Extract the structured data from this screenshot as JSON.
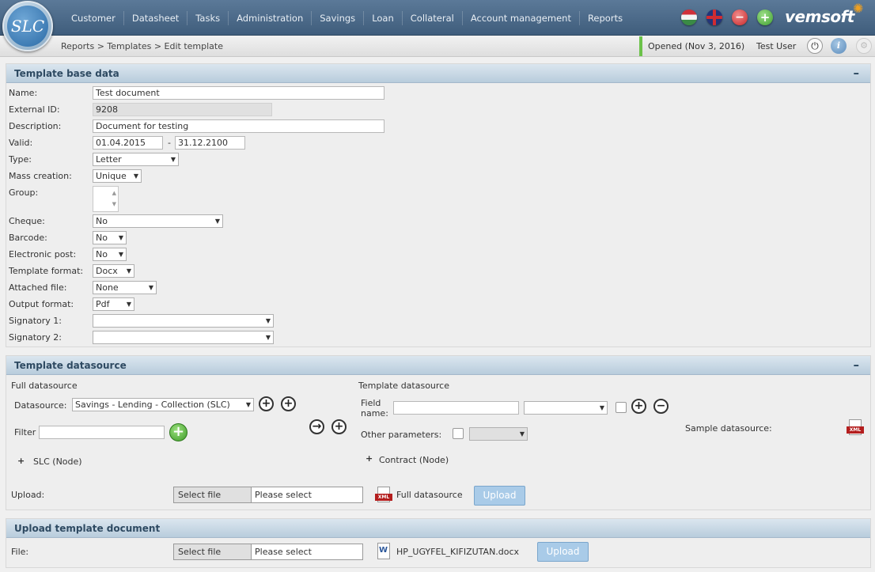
{
  "header": {
    "logo_text": "SLC",
    "menu": [
      "Customer",
      "Datasheet",
      "Tasks",
      "Administration",
      "Savings",
      "Loan",
      "Collateral",
      "Account management",
      "Reports"
    ],
    "brand": "vemsoft"
  },
  "breadcrumb": "Reports  > Templates > Edit template",
  "status": {
    "opened": "Opened (Nov 3, 2016)",
    "user": "Test User"
  },
  "base": {
    "title": "Template base data",
    "collapse": "–",
    "labels": {
      "name": "Name:",
      "external_id": "External ID:",
      "description": "Description:",
      "valid": "Valid:",
      "type": "Type:",
      "mass": "Mass creation:",
      "group": "Group:",
      "cheque": "Cheque:",
      "barcode": "Barcode:",
      "epost": "Electronic post:",
      "tformat": "Template format:",
      "attached": "Attached file:",
      "oformat": "Output format:",
      "sig1": "Signatory 1:",
      "sig2": "Signatory 2:"
    },
    "values": {
      "name": "Test document",
      "external_id": "9208",
      "description": "Document for testing",
      "valid_from": "01.04.2015",
      "valid_sep": "-",
      "valid_to": "31.12.2100",
      "type": "Letter",
      "mass": "Unique",
      "cheque": "No",
      "barcode": "No",
      "epost": "No",
      "tformat": "Docx",
      "attached": "None",
      "oformat": "Pdf",
      "sig1": "",
      "sig2": ""
    }
  },
  "datasource": {
    "title": "Template datasource",
    "collapse": "–",
    "full_title": "Full datasource",
    "datasource_label": "Datasource:",
    "datasource_value": "Savings - Lending - Collection (SLC)",
    "filter_label": "Filter",
    "slc_node": "SLC (Node)",
    "template_title": "Template datasource",
    "field_label_1": "Field",
    "field_label_2": "name:",
    "other_params": "Other parameters:",
    "contract_node": "Contract (Node)",
    "sample": "Sample datasource:",
    "upload_label": "Upload:",
    "select_file": "Select file",
    "please_select": "Please select",
    "full_ds_link": "Full datasource",
    "upload_btn": "Upload",
    "xml_tag": "XML"
  },
  "upload_doc": {
    "title": "Upload template document",
    "file_label": "File:",
    "select_file": "Select file",
    "please_select": "Please select",
    "filename": "HP_UGYFEL_KIFIZUTAN.docx",
    "upload_btn": "Upload",
    "word_tag": "W"
  }
}
